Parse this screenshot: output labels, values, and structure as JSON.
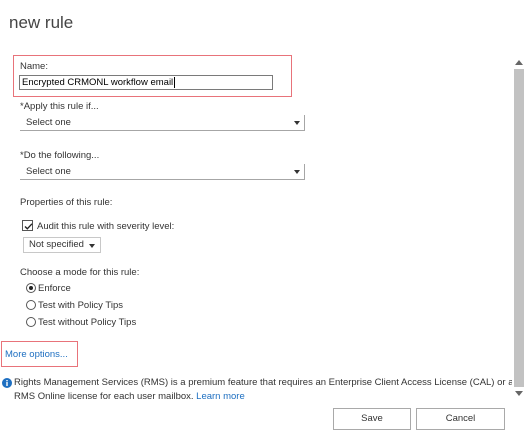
{
  "dialog": {
    "title": "new rule"
  },
  "name_field": {
    "label": "Name:",
    "value": "Encrypted CRMONL workflow email"
  },
  "apply_rule": {
    "label": "*Apply this rule if...",
    "selected": "Select one"
  },
  "do_following": {
    "label": "*Do the following...",
    "selected": "Select one"
  },
  "properties": {
    "label": "Properties of this rule:",
    "audit_label": "Audit this rule with severity level:",
    "audit_checked": true,
    "severity_selected": "Not specified"
  },
  "mode": {
    "label": "Choose a mode for this rule:",
    "options": [
      "Enforce",
      "Test with Policy Tips",
      "Test without Policy Tips"
    ],
    "selected_index": 0
  },
  "more_options": "More options...",
  "info": {
    "text": "Rights Management Services (RMS) is a premium feature that requires an Enterprise Client Access License (CAL) or a RMS Online license for each user mailbox.",
    "link": "Learn more"
  },
  "buttons": {
    "save": "Save",
    "cancel": "Cancel"
  },
  "colors": {
    "highlight": "#e8737a",
    "link": "#1e6fc1"
  },
  "icons": {
    "info": "info-icon",
    "checkmark": "checkmark-icon"
  }
}
